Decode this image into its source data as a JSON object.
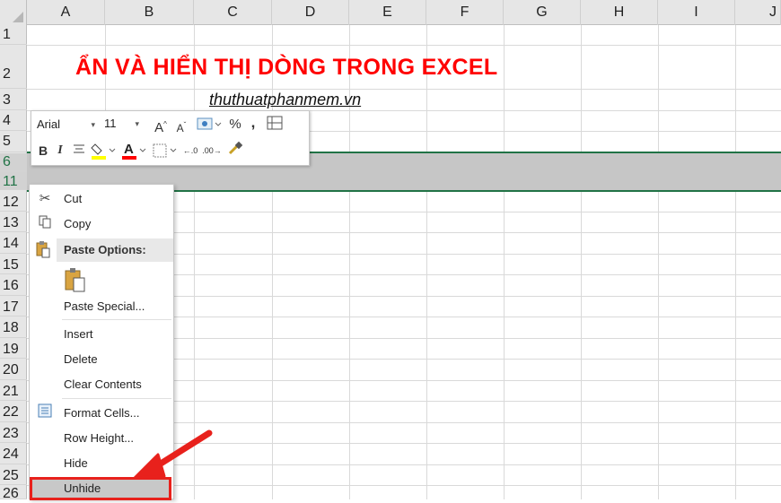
{
  "columns": [
    "A",
    "B",
    "C",
    "D",
    "E",
    "F",
    "G",
    "H",
    "I",
    "J"
  ],
  "rows": [
    "1",
    "2",
    "3",
    "4",
    "5",
    "6",
    "11",
    "12",
    "13",
    "14",
    "15",
    "16",
    "17",
    "18",
    "19",
    "20",
    "21",
    "22",
    "23",
    "24",
    "25",
    "26"
  ],
  "cells": {
    "title": "ẨN VÀ HIỂN THỊ DÒNG TRONG EXCEL",
    "subtitle": "thuthuatphanmem.vn"
  },
  "mini_toolbar": {
    "font_name": "Arial",
    "font_size": "11",
    "bold": "B",
    "italic": "I",
    "font_color_letter": "A",
    "percent": "%",
    "comma": ","
  },
  "context_menu": {
    "cut": "Cut",
    "copy": "Copy",
    "paste_options_header": "Paste Options:",
    "paste_special": "Paste Special...",
    "insert": "Insert",
    "delete": "Delete",
    "clear_contents": "Clear Contents",
    "format_cells": "Format Cells...",
    "row_height": "Row Height...",
    "hide": "Hide",
    "unhide": "Unhide"
  },
  "colors": {
    "title_red": "#ff0000",
    "selection_green": "#217346",
    "highlight_red": "#e8211c"
  },
  "icons": [
    "scissors-icon",
    "copy-icon",
    "paste-icon",
    "paste-clipboard-icon",
    "format-cells-icon",
    "red-arrow"
  ]
}
